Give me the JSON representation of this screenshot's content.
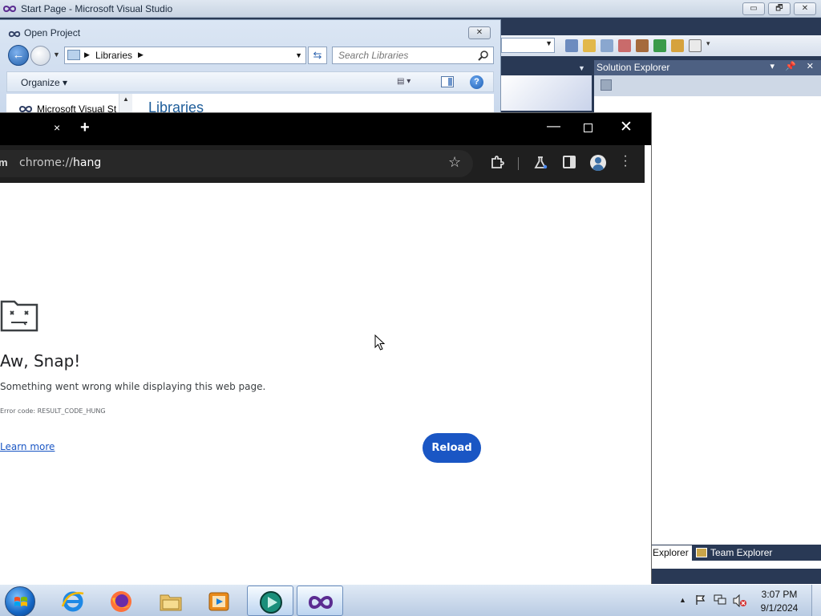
{
  "visual_studio": {
    "title": "Start Page - Microsoft Visual Studio",
    "window_controls": [
      "▭",
      "🗗",
      "✕"
    ],
    "solution_explorer": {
      "title": "Solution Explorer",
      "header_buttons": "▾ 📌 ✕",
      "tabs": [
        "Explorer",
        "Team Explorer"
      ]
    }
  },
  "open_project": {
    "title": "Open Project",
    "close_label": "✕",
    "address": "Libraries",
    "search_placeholder": "Search Libraries",
    "organize": "Organize ▾",
    "nav_item": "Microsoft Visual St",
    "content_heading": "Libraries"
  },
  "chrome": {
    "tab_close": "×",
    "new_tab": "+",
    "url_scheme": "chrome://",
    "url_host": "hang",
    "omni_left": "m",
    "error": {
      "heading": "Aw, Snap!",
      "message": "Something went wrong while displaying this web page.",
      "code": "Error code: RESULT_CODE_HUNG",
      "learn_more": "Learn more",
      "reload": "Reload"
    }
  },
  "taskbar": {
    "apps": [
      "start",
      "internet-explorer",
      "firefox",
      "file-explorer",
      "media-player",
      "app-green",
      "visual-studio"
    ],
    "clock_time": "3:07 PM",
    "clock_date": "9/1/2024"
  },
  "colors": {
    "vs_frame": "#293955",
    "chrome_dark": "#1f1f1f",
    "reload_blue": "#1a56c4"
  }
}
